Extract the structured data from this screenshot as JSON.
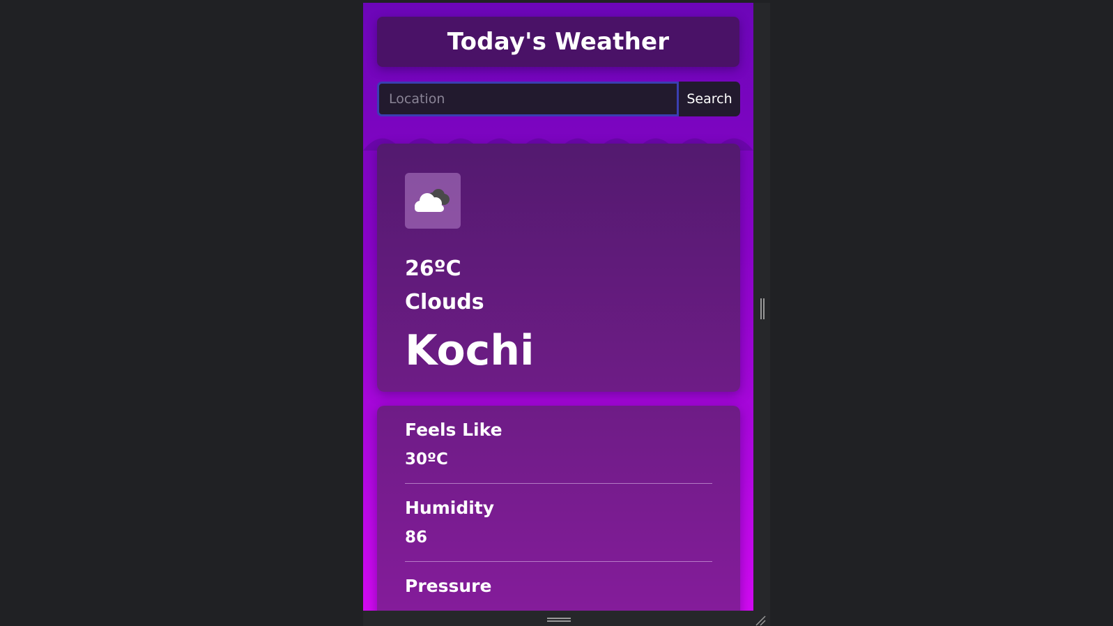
{
  "header": {
    "title": "Today's Weather"
  },
  "search": {
    "placeholder": "Location",
    "value": "",
    "button_label": "Search"
  },
  "current": {
    "icon": "clouds-icon",
    "temperature": "26ºC",
    "condition": "Clouds",
    "city": "Kochi"
  },
  "details": [
    {
      "label": "Feels Like",
      "value": "30ºC"
    },
    {
      "label": "Humidity",
      "value": "86"
    },
    {
      "label": "Pressure",
      "value": ""
    }
  ],
  "colors": {
    "background_top": "#6c06b8",
    "background_bottom": "#d20af2",
    "card": "#5b1a75",
    "input_bg": "#221a2e",
    "input_border": "#3a3fb2"
  }
}
